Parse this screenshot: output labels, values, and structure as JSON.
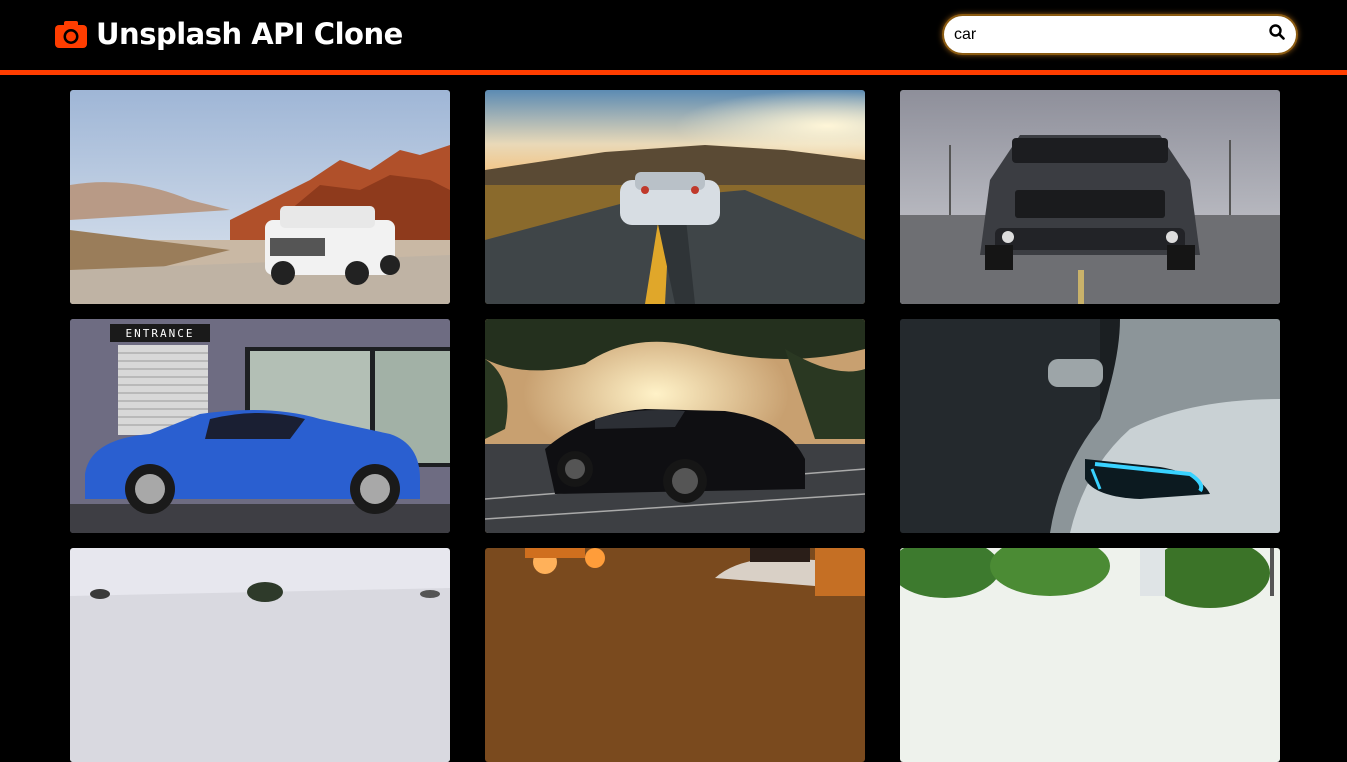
{
  "header": {
    "title": "Unsplash API Clone",
    "logo_icon": "camera-icon",
    "accent_color": "#ff3d00"
  },
  "search": {
    "value": "car",
    "icon": "search-icon"
  },
  "photos": [
    {
      "subject": "white SUV in red rock desert"
    },
    {
      "subject": "white sports car on winding road at sunset"
    },
    {
      "subject": "dark grey muscle car front view"
    },
    {
      "subject": "blue coupe in front of ENTRANCE garage",
      "sign_text": "ENTRANCE"
    },
    {
      "subject": "black muscle car under trees at sunset"
    },
    {
      "subject": "silver car headlight in dark garage"
    },
    {
      "subject": "partially visible photo"
    },
    {
      "subject": "partially visible photo"
    },
    {
      "subject": "partially visible photo"
    }
  ]
}
